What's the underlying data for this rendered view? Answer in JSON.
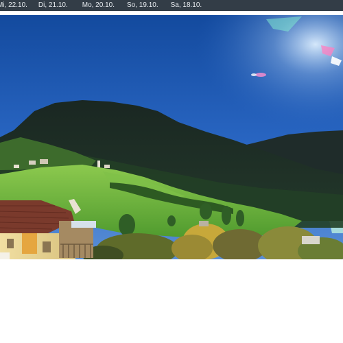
{
  "date_nav": {
    "tabs": [
      {
        "label": "Mi, 22.10."
      },
      {
        "label": "Di, 21.10."
      },
      {
        "label": "Mo, 20.10."
      },
      {
        "label": "So, 19.10."
      },
      {
        "label": "Sa, 18.10."
      }
    ]
  },
  "colors": {
    "bar_background": "#333d47",
    "bar_text": "#e8ecf0",
    "sky": "#1e5ab8",
    "mountain": "#1c2a22",
    "meadow": "#5fa83a"
  }
}
